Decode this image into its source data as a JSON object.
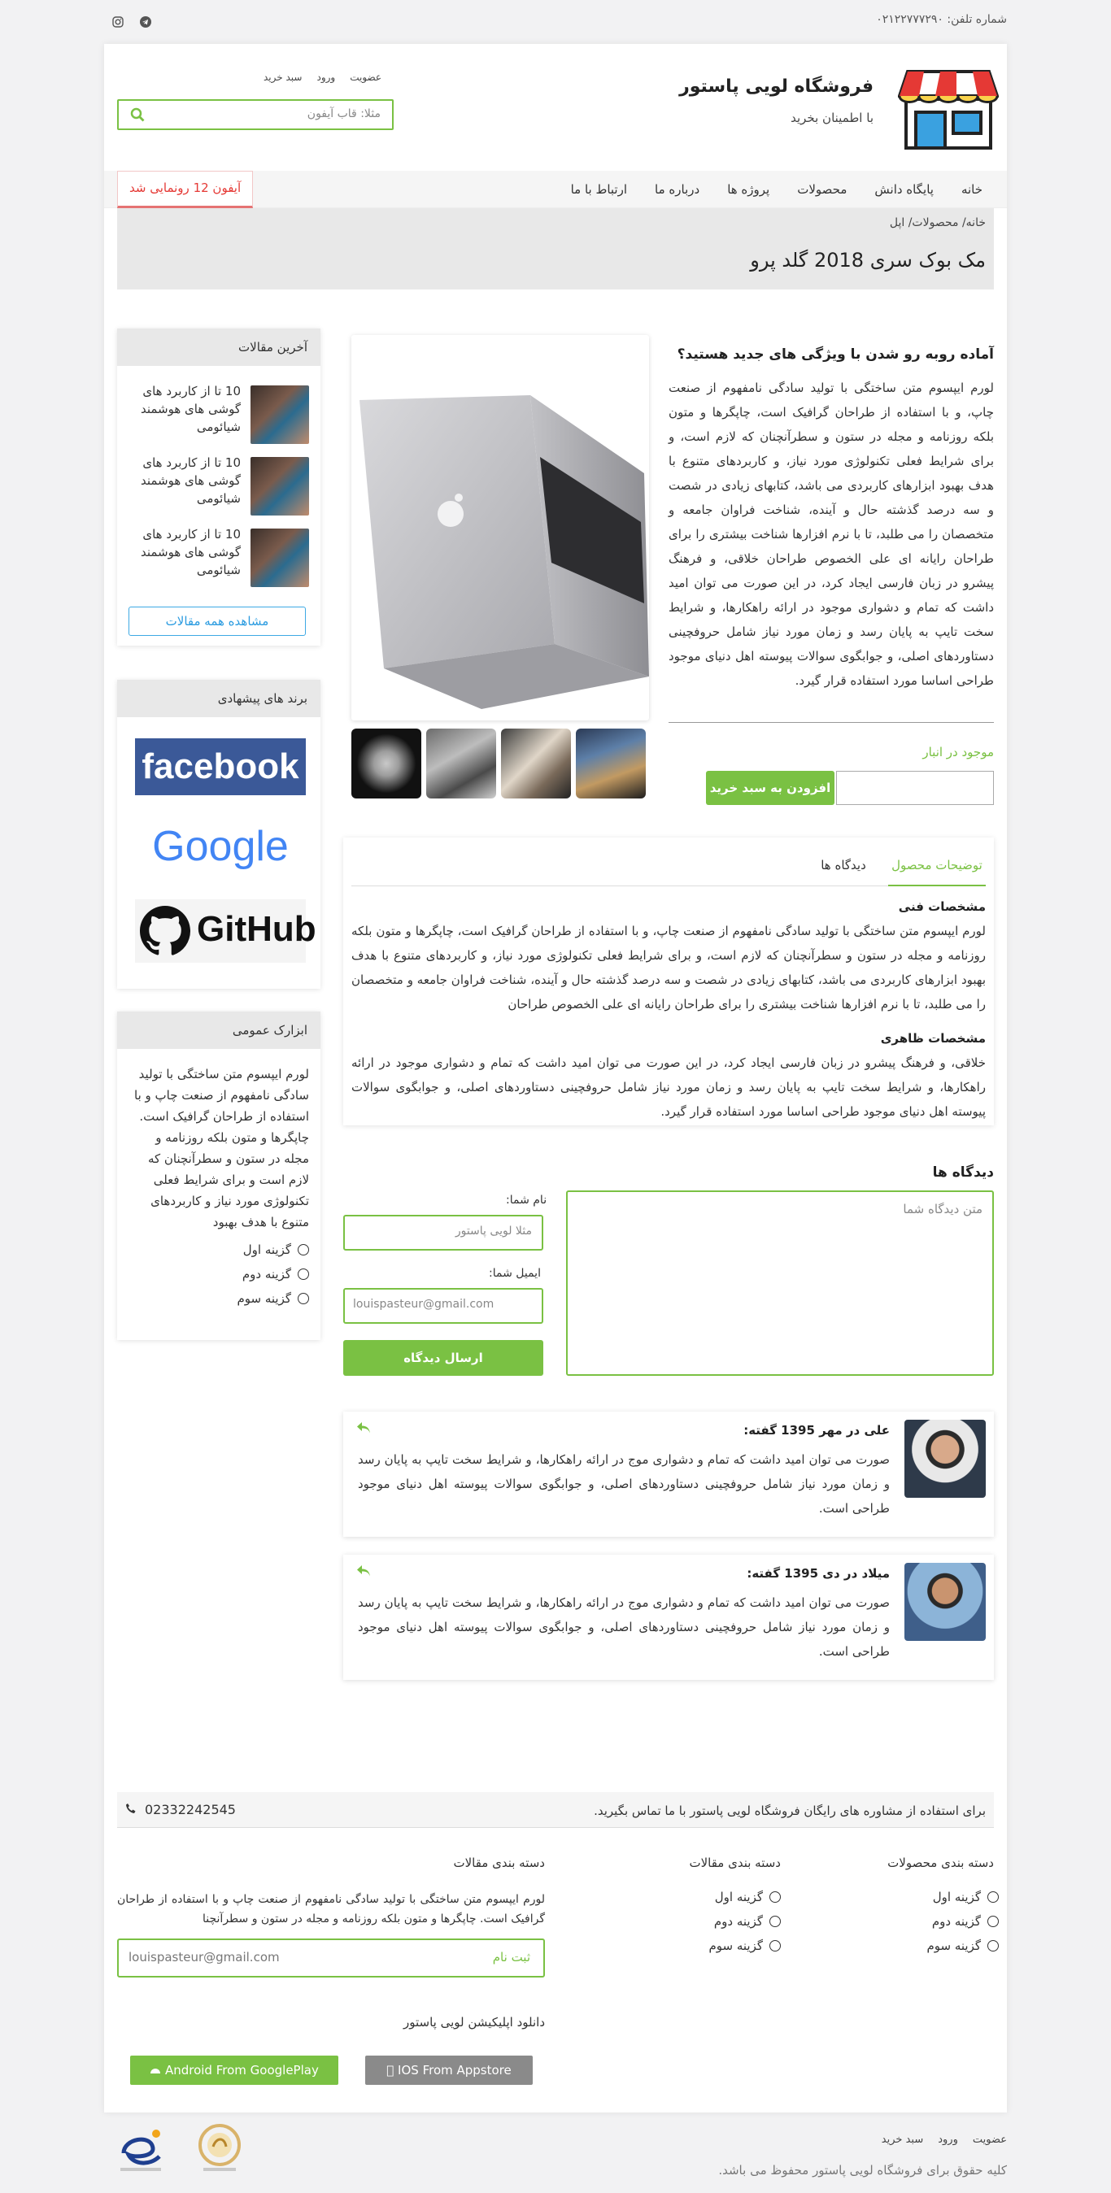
{
  "topbar": {
    "phone": "شماره تلفن: ۰۲۱۲۲۷۷۷۲۹۰",
    "social": [
      "telegram-icon",
      "instagram-icon"
    ]
  },
  "header": {
    "store_name": "فروشگاه لویی پاستور",
    "tagline": "با اطمینان بخرید",
    "links": [
      "عضویت",
      "ورود",
      "سبد خرید"
    ],
    "search_placeholder": "مثلا: قاب آیفون"
  },
  "nav": {
    "items": [
      "خانه",
      "پایگاه دانش",
      "محصولات",
      "پروژه ها",
      "درباره ما",
      "ارتباط با ما"
    ],
    "promo": "آیفون 12 رونمایی شد"
  },
  "breadcrumb": {
    "path": "خانه/ محصولات/ اپل",
    "title": "مک بوک سری 2018 گلد پرو"
  },
  "sidebar": {
    "articles": {
      "title": "آخرین مقالات",
      "items": [
        "10 تا از کاربرد های گوشی های هوشمند شیائومی",
        "10 تا از کاربرد های گوشی های هوشمند شیائومی",
        "10 تا از کاربرد های گوشی های هوشمند شیائومی"
      ],
      "view_all": "مشاهده همه مقالات"
    },
    "brands": {
      "title": "برند های پیشهادی",
      "items": [
        "facebook",
        "Google",
        "GitHub"
      ]
    },
    "tools": {
      "title": "ابزارک عمومی",
      "text": "لورم ایپسوم متن ساختگی با تولید سادگی نامفهوم از صنعت چاپ و با استفاده از طراحان گرافیک است. چاپگرها و متون بلکه روزنامه و مجله در ستون و سطرآنچنان که لازم است و برای شرایط فعلی تکنولوژی مورد نیاز و کاربردهای متنوع با هدف بهبود",
      "options": [
        "گزینه اول",
        "گزینه دوم",
        "گزینه سوم"
      ]
    }
  },
  "product": {
    "heading": "آماده روبه رو شدن با ویژگی های جدید هستید؟",
    "description": "لورم ایپسوم متن ساختگی با تولید سادگی نامفهوم از صنعت چاپ، و با استفاده از طراحان گرافیک است، چاپگرها و متون بلکه روزنامه و مجله در ستون و سطرآنچنان که لازم است، و برای شرایط فعلی تکنولوژی مورد نیاز، و کاربردهای متنوع با هدف بهبود ابزارهای کاربردی می باشد، کتابهای زیادی در شصت و سه درصد گذشته حال و آینده، شناخت فراوان جامعه و متخصصان را می طلبد، تا با نرم افزارها شناخت بیشتری را برای طراحان رایانه ای علی الخصوص طراحان خلاقی، و فرهنگ پیشرو در زبان فارسی ایجاد کرد، در این صورت می توان امید داشت که تمام و دشواری موجود در ارائه راهکارها، و شرایط سخت تایپ به پایان رسد و زمان مورد نیاز شامل حروفچینی دستاوردهای اصلی، و جوابگوی سوالات پیوسته اهل دنیای موجود طراحی اساسا مورد استفاده قرار گیرد.",
    "stock": "موجود در انبار",
    "add_to_cart": "افزودن به سبد خرید"
  },
  "tabs": {
    "items": [
      "توضیحات محصول",
      "دیدگاه ها"
    ],
    "spec_title": "مشخصات فنی",
    "spec_text": "لورم ایپسوم متن ساختگی با تولید سادگی نامفهوم از صنعت چاپ، و با استفاده از طراحان گرافیک است، چاپگرها و متون بلکه روزنامه و مجله در ستون و سطرآنچنان که لازم است، و برای شرایط فعلی تکنولوژی مورد نیاز، و کاربردهای متنوع با هدف بهبود ابزارهای کاربردی می باشد، کتابهای زیادی در شصت و سه درصد گذشته حال و آینده، شناخت فراوان جامعه و متخصصان را می طلبد، تا با نرم افزارها شناخت بیشتری را برای طراحان رایانه ای علی الخصوص طراحان",
    "look_title": "مشخصات ظاهری",
    "look_text": "خلاقی، و فرهنگ پیشرو در زبان فارسی ایجاد کرد، در این صورت می توان امید داشت که تمام و دشواری موجود در ارائه راهکارها، و شرایط سخت تایپ به پایان رسد و زمان مورد نیاز شامل حروفچینی دستاوردهای اصلی، و جوابگوی سوالات پیوسته اهل دنیای موجود طراحی اساسا مورد استفاده قرار گیرد."
  },
  "comments": {
    "title": "دیدگاه ها",
    "text_placeholder": "متن دیدگاه شما",
    "name_label": "نام شما:",
    "name_placeholder": "مثلا لویی پاستور",
    "email_label": "ایمیل شما:",
    "email_placeholder": "louispasteur@gmail.com",
    "submit": "ارسال دیدگاه",
    "reviews": [
      {
        "author": "علی در مهر 1395 گفته:",
        "text": "صورت می توان امید داشت که تمام و دشواری موج در ارائه راهکارها، و شرایط سخت تایپ به پایان رسد و زمان مورد نیاز شامل حروفچینی دستاوردهای اصلی، و جوابگوی سوالات پیوسته اهل دنیای موجود طراحی است."
      },
      {
        "author": "میلاد در دی 1395 گفته:",
        "text": "صورت می توان امید داشت که تمام و دشواری موج در ارائه راهکارها، و شرایط سخت تایپ به پایان رسد و زمان مورد نیاز شامل حروفچینی دستاوردهای اصلی، و جوابگوی سوالات پیوسته اهل دنیای موجود طراحی است."
      }
    ]
  },
  "footer": {
    "consult": "برای استفاده از مشاوره های رایگان فروشگاه لویی پاستور با ما تماس بگیرید.",
    "phone": "02332242545",
    "product_cats": {
      "title": "دسته بندی محصولات",
      "items": [
        "گزینه اول",
        "گزینه دوم",
        "گزینه سوم"
      ]
    },
    "article_cats": {
      "title": "دسته بندی مقالات",
      "items": [
        "گزینه اول",
        "گزینه دوم",
        "گزینه سوم"
      ]
    },
    "articles_col": {
      "title": "دسته بندی مقالات",
      "text": "لورم ایپسوم متن ساختگی با تولید سادگی نامفهوم از صنعت چاپ و با استفاده از طراحان گرافیک است. چاپگرها و متون بلکه روزنامه و مجله در ستون و سطرآنچنا",
      "newsletter_placeholder": "louispasteur@gmail.com",
      "newsletter_button": "ثبت نام"
    },
    "app": {
      "title": "دانلود اپلیکیشن لویی پاستور",
      "ios": "IOS From Appstore",
      "android": "Android From GooglePlay"
    },
    "bottom_links": [
      "عضویت",
      "ورود",
      "سبد خرید"
    ],
    "copyright": "کلیه حقوق برای فروشگاه لویی پاستور محفوظ می باشد."
  }
}
